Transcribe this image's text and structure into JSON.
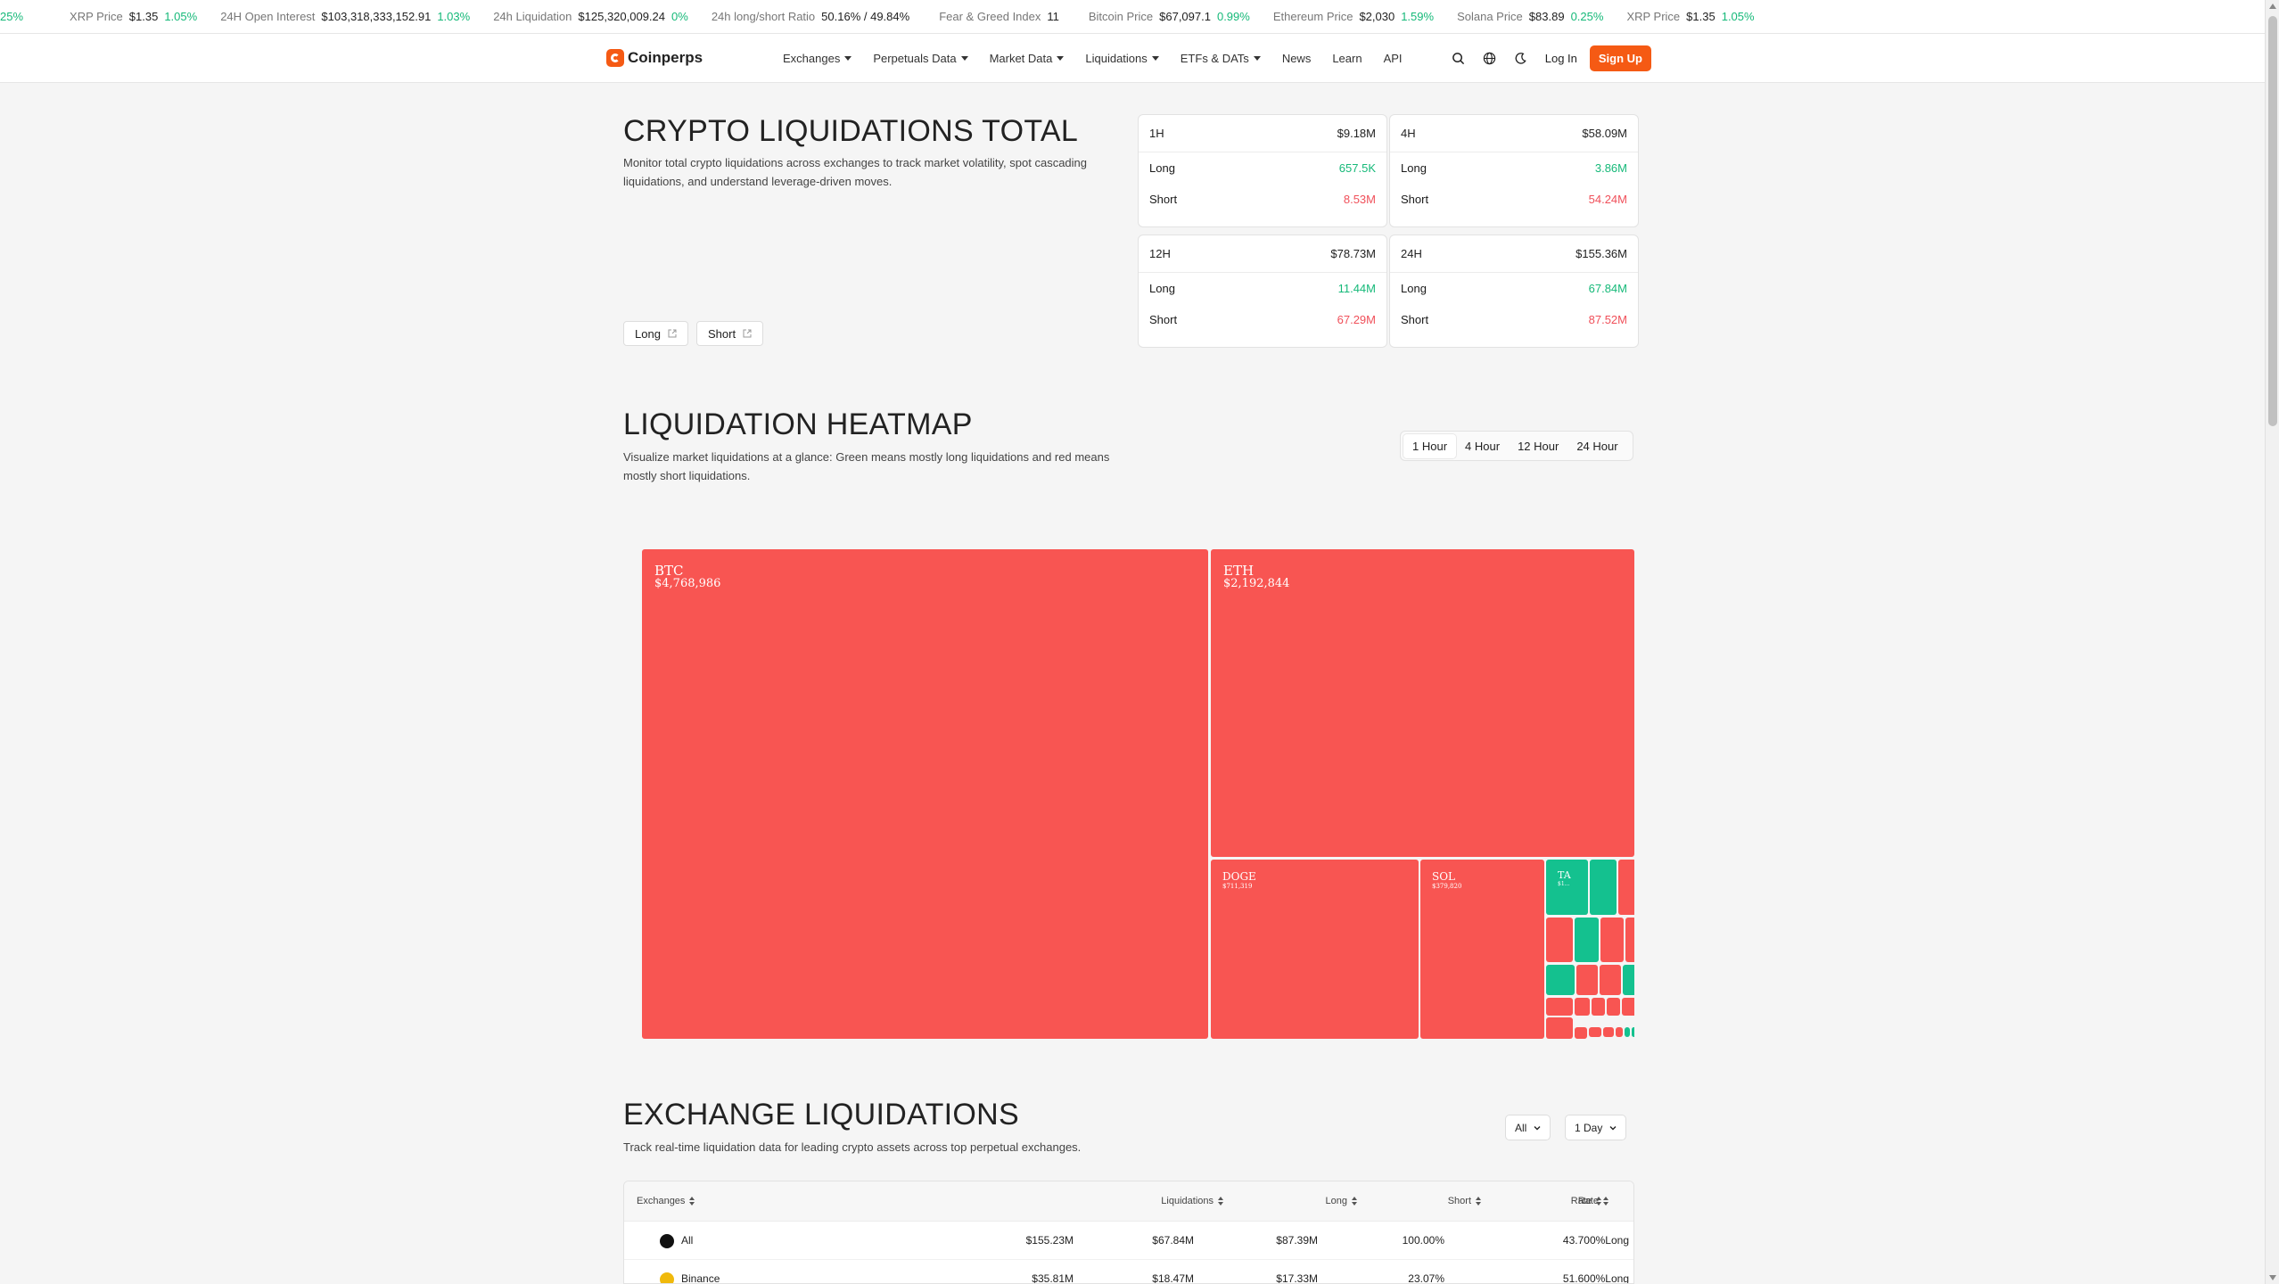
{
  "ticker": {
    "lead": "25%",
    "items": [
      {
        "label": "XRP Price",
        "value": "$1.35",
        "change": "1.05%"
      },
      {
        "label": "24H Open Interest",
        "value": "$103,318,333,152.91",
        "change": "1.03%"
      },
      {
        "label": "24h Liquidation",
        "value": "$125,320,009.24",
        "change": "0%"
      },
      {
        "label": "24h long/short Ratio",
        "value": "50.16% / 49.84%",
        "change": ""
      },
      {
        "label": "Fear & Greed Index",
        "value": "11",
        "change": ""
      },
      {
        "label": "Bitcoin Price",
        "value": "$67,097.1",
        "change": "0.99%"
      },
      {
        "label": "Ethereum Price",
        "value": "$2,030",
        "change": "1.59%"
      },
      {
        "label": "Solana Price",
        "value": "$83.89",
        "change": "0.25%"
      },
      {
        "label": "XRP Price",
        "value": "$1.35",
        "change": "1.05%"
      }
    ]
  },
  "nav": {
    "brand": "Coinperps",
    "menu": [
      {
        "label": "Exchanges",
        "dropdown": true
      },
      {
        "label": "Perpetuals Data",
        "dropdown": true
      },
      {
        "label": "Market Data",
        "dropdown": true
      },
      {
        "label": "Liquidations",
        "dropdown": true
      },
      {
        "label": "ETFs & DATs",
        "dropdown": true
      },
      {
        "label": "News",
        "dropdown": false
      },
      {
        "label": "Learn",
        "dropdown": false
      },
      {
        "label": "API",
        "dropdown": false
      }
    ],
    "login": "Log In",
    "signup": "Sign Up"
  },
  "totals": {
    "title": "CRYPTO LIQUIDATIONS TOTAL",
    "description": "Monitor total crypto liquidations across exchanges to track market volatility, spot cascading liquidations, and understand leverage-driven moves.",
    "long_button": "Long",
    "short_button": "Short",
    "cards": [
      {
        "period": "1H",
        "total": "$9.18M",
        "long_label": "Long",
        "long": "657.5K",
        "short_label": "Short",
        "short": "8.53M"
      },
      {
        "period": "4H",
        "total": "$58.09M",
        "long_label": "Long",
        "long": "3.86M",
        "short_label": "Short",
        "short": "54.24M"
      },
      {
        "period": "12H",
        "total": "$78.73M",
        "long_label": "Long",
        "long": "11.44M",
        "short_label": "Short",
        "short": "67.29M"
      },
      {
        "period": "24H",
        "total": "$155.36M",
        "long_label": "Long",
        "long": "67.84M",
        "short_label": "Short",
        "short": "87.52M"
      }
    ]
  },
  "heatmap": {
    "title": "LIQUIDATION HEATMAP",
    "description": "Visualize market liquidations at a glance: Green means mostly long liquidations and red means mostly short liquidations.",
    "tabs": [
      "1 Hour",
      "4 Hour",
      "12 Hour",
      "24 Hour"
    ],
    "active_tab": "1 Hour",
    "colors": {
      "short": "#f85552",
      "long": "#14c18f"
    },
    "cells": [
      {
        "name": "BTC",
        "value": "$4,768,986",
        "side": "short"
      },
      {
        "name": "ETH",
        "value": "$2,192,844",
        "side": "short"
      },
      {
        "name": "DOGE",
        "value": "$711,319",
        "side": "short"
      },
      {
        "name": "SOL",
        "value": "$379,820",
        "side": "short"
      },
      {
        "name": "TA",
        "value": "$1...",
        "side": "long"
      }
    ]
  },
  "exchange": {
    "title": "EXCHANGE LIQUIDATIONS",
    "description": "Track real-time liquidation data for leading crypto assets across top perpetual exchanges.",
    "filter_asset": "All",
    "filter_period": "1 Day",
    "columns": [
      "Exchanges",
      "Liquidations",
      "Long",
      "Short",
      "Rate",
      "Rate"
    ],
    "rows": [
      {
        "name": "All",
        "liquidations": "$155.23M",
        "long": "$67.84M",
        "short": "$87.39M",
        "rate": "100.00%",
        "rate2": "43.700%Long",
        "dot": "#111111"
      },
      {
        "name": "Binance",
        "liquidations": "$35.81M",
        "long": "$18.47M",
        "short": "$17.33M",
        "rate": "23.07%",
        "rate2": "51.600%Long",
        "dot": "#f0b90b"
      }
    ]
  }
}
